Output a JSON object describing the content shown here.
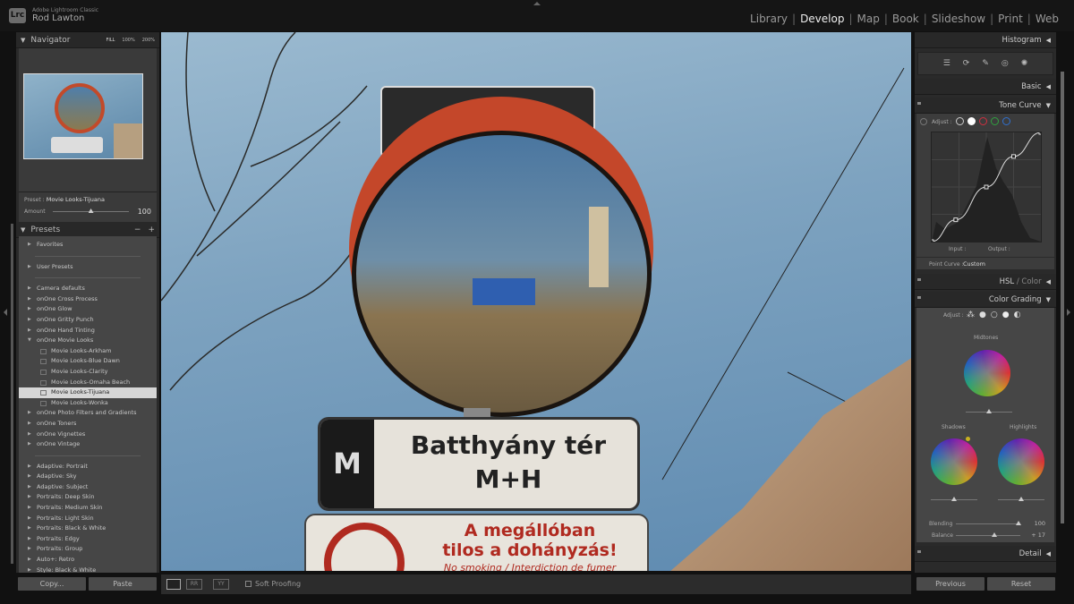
{
  "app": {
    "logo": "Lrc",
    "name": "Adobe Lightroom Classic",
    "user": "Rod Lawton"
  },
  "modules": [
    {
      "label": "Library"
    },
    {
      "label": "Develop",
      "active": true
    },
    {
      "label": "Map"
    },
    {
      "label": "Book"
    },
    {
      "label": "Slideshow"
    },
    {
      "label": "Print"
    },
    {
      "label": "Web"
    }
  ],
  "navigator": {
    "title": "Navigator",
    "zoom_options": [
      "FILL",
      "100%",
      "200%"
    ]
  },
  "preset_info": {
    "label": "Preset :",
    "value": "Movie Looks-Tijuana",
    "amount_label": "Amount",
    "amount": "100",
    "amount_fraction": 0.5
  },
  "presets": {
    "title": "Presets",
    "minus": "−",
    "plus": "+",
    "groups": [
      {
        "items": [
          {
            "label": "Favorites"
          }
        ]
      },
      {
        "items": [
          {
            "label": "User Presets"
          }
        ]
      },
      {
        "items": [
          {
            "label": "Camera defaults"
          },
          {
            "label": "onOne Cross Process"
          },
          {
            "label": "onOne Glow"
          },
          {
            "label": "onOne Gritty Punch"
          },
          {
            "label": "onOne Hand Tinting"
          },
          {
            "label": "onOne Movie Looks",
            "expanded": true,
            "children": [
              "Movie Looks-Arkham",
              "Movie Looks-Blue Dawn",
              "Movie Looks-Clarity",
              "Movie Looks-Omaha Beach",
              "Movie Looks-Tijuana",
              "Movie Looks-Wonka"
            ],
            "selected": "Movie Looks-Tijuana"
          },
          {
            "label": "onOne Photo Filters and Gradients"
          },
          {
            "label": "onOne Toners"
          },
          {
            "label": "onOne Vignettes"
          },
          {
            "label": "onOne Vintage"
          }
        ]
      },
      {
        "items": [
          {
            "label": "Adaptive: Portrait"
          },
          {
            "label": "Adaptive: Sky"
          },
          {
            "label": "Adaptive: Subject"
          },
          {
            "label": "Portraits: Deep Skin"
          },
          {
            "label": "Portraits: Medium Skin"
          },
          {
            "label": "Portraits: Light Skin"
          },
          {
            "label": "Portraits: Black & White"
          },
          {
            "label": "Portraits: Edgy"
          },
          {
            "label": "Portraits: Group"
          },
          {
            "label": "Auto+: Retro"
          },
          {
            "label": "Style: Black & White"
          }
        ]
      }
    ]
  },
  "left_buttons": {
    "copy": "Copy...",
    "paste": "Paste"
  },
  "photo": {
    "sign_line1": "Batthyány tér",
    "sign_line2": "M+H",
    "sign_badge": "M",
    "notice_line1": "A megállóban",
    "notice_line2": "tilos a dohányzás!",
    "notice_line3": "No smoking / Interdiction de fumer"
  },
  "toolbar": {
    "soft_proofing": "Soft Proofing",
    "view_modes": [
      "loupe-icon",
      "compare-icon",
      "survey-icon"
    ]
  },
  "right": {
    "histogram": "Histogram",
    "tools": [
      "sliders-icon",
      "crop-icon",
      "healing-icon",
      "redeye-icon",
      "masking-icon"
    ],
    "basic": "Basic",
    "tone_curve": {
      "title": "Tone Curve",
      "adjust": "Adjust :",
      "channels": [
        "parametric",
        "point-rgb",
        "red",
        "green",
        "blue"
      ],
      "channel_colors": [
        "#cccccc",
        "#ffffff",
        "#d03040",
        "#30a040",
        "#3070d0"
      ],
      "input": "Input :",
      "output": "Output :",
      "point_curve_label": "Point Curve :",
      "point_curve_value": "Custom",
      "points": [
        [
          0,
          0
        ],
        [
          0.22,
          0.2
        ],
        [
          0.5,
          0.5
        ],
        [
          0.75,
          0.78
        ],
        [
          1,
          1
        ]
      ]
    },
    "hsl": "HSL",
    "hsl_color": "Color",
    "color_grading": {
      "title": "Color Grading",
      "adjust": "Adjust :",
      "midtones": "Midtones",
      "shadows": "Shadows",
      "highlights": "Highlights",
      "blending_label": "Blending",
      "blending": "100",
      "balance_label": "Balance",
      "balance": "+ 17"
    },
    "detail": "Detail",
    "previous": "Previous",
    "reset": "Reset"
  }
}
